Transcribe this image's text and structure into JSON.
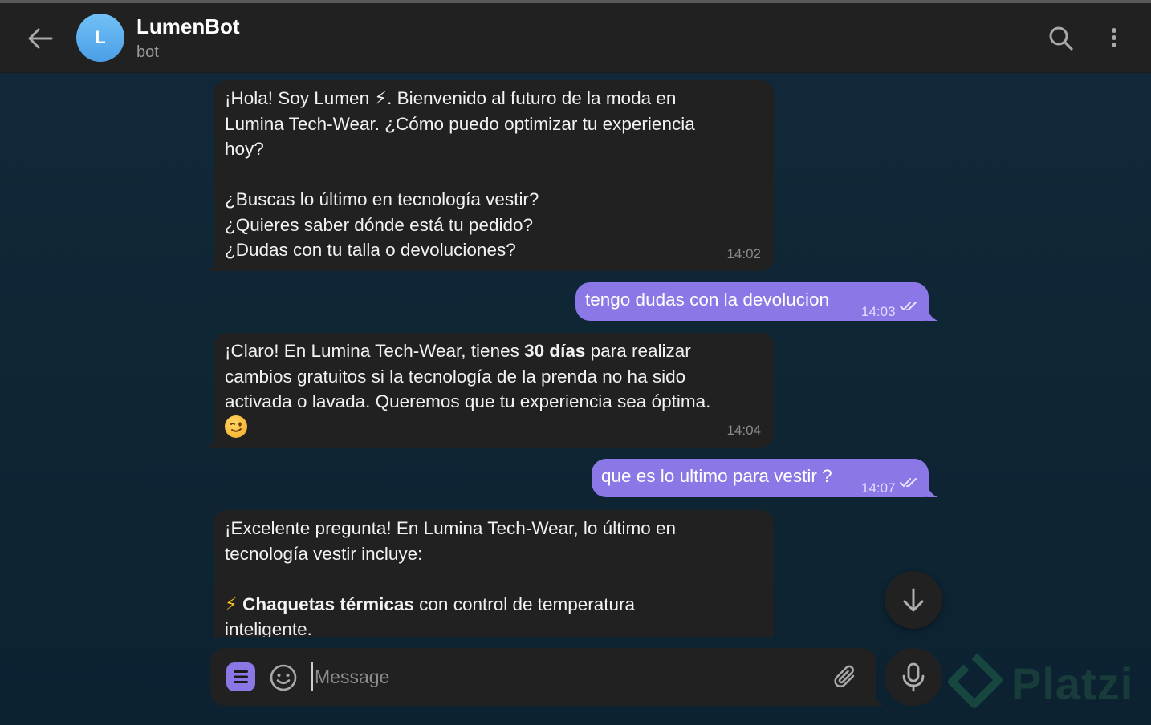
{
  "header": {
    "avatar_letter": "L",
    "title": "LumenBot",
    "status": "bot"
  },
  "messages": [
    {
      "direction": "in",
      "lines": [
        "¡Hola! Soy Lumen ⚡. Bienvenido al futuro de la moda en",
        "Lumina Tech-Wear. ¿Cómo puedo optimizar tu experiencia",
        "hoy?",
        "",
        "¿Buscas lo último en tecnología vestir?",
        "¿Quieres saber dónde está tu pedido?",
        "¿Dudas con tu talla o devoluciones?"
      ],
      "time": "14:02"
    },
    {
      "direction": "out",
      "text": "tengo dudas con la devolucion",
      "time": "14:03",
      "status": "read"
    },
    {
      "direction": "in",
      "line1_before": "¡Claro! En Lumina Tech-Wear, tienes ",
      "line1_bold": "30 días",
      "line1_after": " para realizar",
      "line2": "cambios gratuitos si la tecnología de la prenda no ha sido",
      "line3": "activada o lavada. Queremos que tu experiencia sea óptima.",
      "emoji": "wink-emoji",
      "time": "14:04"
    },
    {
      "direction": "out",
      "text": "que es lo ultimo para vestir ?",
      "time": "14:07",
      "status": "read"
    },
    {
      "direction": "in",
      "line1": "¡Excelente pregunta! En Lumina Tech-Wear, lo último en",
      "line2": "tecnología vestir incluye:",
      "bullet_icon": "⚡",
      "bullet_bold": "Chaquetas térmicas",
      "bullet_after": " con control de temperatura",
      "bullet_line2": "inteligente."
    }
  ],
  "composer": {
    "placeholder": "Message"
  },
  "watermark": "Platzi",
  "colors": {
    "header_bg": "#212121",
    "incoming_bubble": "#212121",
    "outgoing_bubble": "#8b78e6",
    "avatar": "#5aaef0",
    "chat_bg": "#0f2635"
  },
  "icons": [
    "arrow-left-icon",
    "search-icon",
    "more-vertical-icon",
    "double-check-icon",
    "arrow-down-icon",
    "bot-menu-icon",
    "smile-icon",
    "paperclip-icon",
    "microphone-icon",
    "platzi-logo-icon"
  ]
}
